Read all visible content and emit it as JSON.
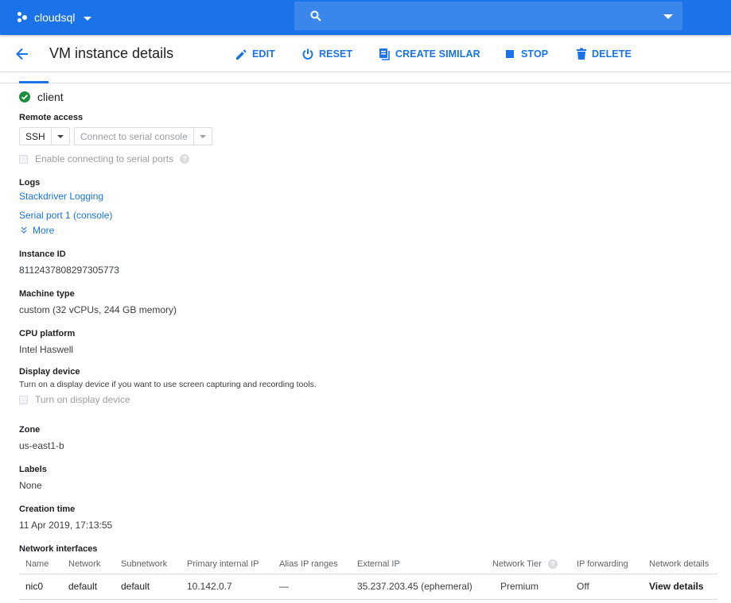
{
  "topbar": {
    "project_name": "cloudsql",
    "search_placeholder": "",
    "search_value": ""
  },
  "header": {
    "title": "VM instance details",
    "actions": [
      {
        "label": "EDIT",
        "icon": "pencil-icon"
      },
      {
        "label": "RESET",
        "icon": "power-icon"
      },
      {
        "label": "CREATE SIMILAR",
        "icon": "copy-icon"
      },
      {
        "label": "STOP",
        "icon": "stop-icon"
      },
      {
        "label": "DELETE",
        "icon": "trash-icon"
      }
    ]
  },
  "instance": {
    "name": "client",
    "status": "running",
    "status_color": "#1e8e3e"
  },
  "remote_access": {
    "label": "Remote access",
    "ssh_label": "SSH",
    "serial_console_label": "Connect to serial console",
    "enable_serial_label": "Enable connecting to serial ports",
    "enable_serial_checked": false
  },
  "logs": {
    "label": "Logs",
    "links": [
      "Stackdriver Logging",
      "Serial port 1 (console)"
    ],
    "more_label": "More"
  },
  "details": {
    "instance_id": {
      "label": "Instance ID",
      "value": "8112437808297305773"
    },
    "machine_type": {
      "label": "Machine type",
      "value": "custom (32 vCPUs, 244 GB memory)"
    },
    "cpu_platform": {
      "label": "CPU platform",
      "value": "Intel Haswell"
    },
    "display_device": {
      "label": "Display device",
      "description": "Turn on a display device if you want to use screen capturing and recording tools.",
      "checkbox_label": "Turn on display device",
      "checked": false
    },
    "zone": {
      "label": "Zone",
      "value": "us-east1-b"
    },
    "labels": {
      "label": "Labels",
      "value": "None"
    },
    "creation_time": {
      "label": "Creation time",
      "value": "11 Apr 2019, 17:13:55"
    }
  },
  "network_interfaces": {
    "label": "Network interfaces",
    "columns": [
      "Name",
      "Network",
      "Subnetwork",
      "Primary internal IP",
      "Alias IP ranges",
      "External IP",
      "Network Tier",
      "IP forwarding",
      "Network details"
    ],
    "rows": [
      [
        "nic0",
        "default",
        "default",
        "10.142.0.7",
        "—",
        "35.237.203.45 (ephemeral)",
        "Premium",
        "Off",
        "View details"
      ]
    ]
  },
  "colors": {
    "brand_blue": "#1a73e8",
    "success_green": "#1e8e3e"
  }
}
